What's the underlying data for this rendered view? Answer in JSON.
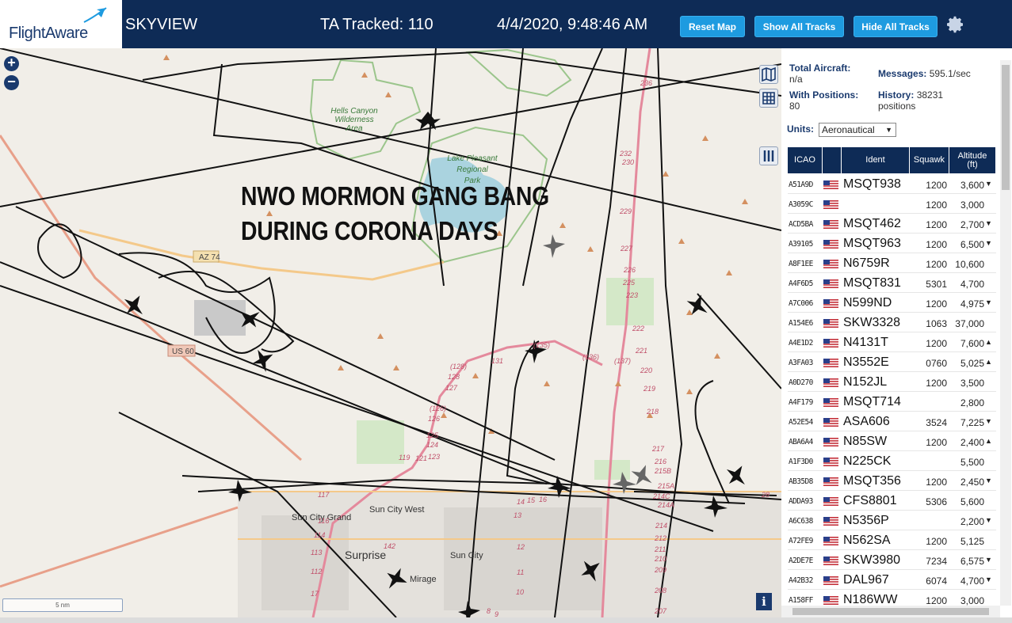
{
  "header": {
    "logo_text": "FlightAware",
    "app_name": "SKYVIEW",
    "tracked_label": "TA Tracked: 110",
    "datetime": "4/4/2020, 9:48:46 AM",
    "buttons": {
      "reset_map": "Reset Map",
      "show_all_tracks": "Show All Tracks",
      "hide_all_tracks": "Hide All Tracks"
    },
    "colors": {
      "bar": "#0e2b56",
      "button": "#1e9be0"
    }
  },
  "map": {
    "zoom_in": "+",
    "zoom_out": "−",
    "overlay_lines": [
      "NWO MORMON GANG BANG",
      "DURING CORONA DAYS"
    ],
    "scale_label": "5 nm",
    "info_icon": "i",
    "labels": {
      "hells_canyon": [
        "Hells Canyon",
        "Wilderness",
        "Area"
      ],
      "lake_pleasant": [
        "Lake Pleasant",
        "Regional",
        "Park"
      ],
      "az74": "AZ 74",
      "us60": "US 60",
      "sun_city_grand": "Sun City Grand",
      "sun_city_west": "Sun City West",
      "surprise": "Surprise",
      "sun_city": "Sun City",
      "el_mirage": "Mirage"
    },
    "road_numbers": [
      "236",
      "232",
      "230",
      "229",
      "227",
      "226",
      "225",
      "223",
      "222",
      "221",
      "220",
      "219",
      "218",
      "217",
      "216",
      "215B",
      "215A",
      "214C",
      "214A",
      "214",
      "212",
      "211",
      "210",
      "209",
      "208",
      "207",
      "(135)",
      "(136)",
      "(137)",
      "131",
      "(128)",
      "128",
      "127",
      "(126)",
      "126",
      "125",
      "124",
      "123",
      "121",
      "119",
      "117",
      "116",
      "114",
      "113",
      "112",
      "17",
      "16",
      "15",
      "14",
      "13",
      "12",
      "11",
      "10",
      "9",
      "8",
      "142",
      "28"
    ]
  },
  "panel": {
    "total_aircraft_label": "Total Aircraft:",
    "total_aircraft_value": "n/a",
    "with_positions_label": "With Positions:",
    "with_positions_value": "80",
    "messages_label": "Messages:",
    "messages_value": "595.1/sec",
    "history_label": "History:",
    "history_value": "38231",
    "history_unit": "positions",
    "units_label": "Units:",
    "units_value": "Aeronautical",
    "columns": {
      "icao": "ICAO",
      "ident": "Ident",
      "squawk": "Squawk",
      "altitude": "Altitude",
      "altitude_unit": "(ft)"
    },
    "rows": [
      {
        "icao": "A51A9D",
        "ident": "MSQT938",
        "squawk": "1200",
        "alt": "3,600",
        "trend": "▼"
      },
      {
        "icao": "A3059C",
        "ident": "",
        "squawk": "1200",
        "alt": "3,000",
        "trend": ""
      },
      {
        "icao": "ACD5BA",
        "ident": "MSQT462",
        "squawk": "1200",
        "alt": "2,700",
        "trend": "▼"
      },
      {
        "icao": "A39105",
        "ident": "MSQT963",
        "squawk": "1200",
        "alt": "6,500",
        "trend": "▼"
      },
      {
        "icao": "A8F1EE",
        "ident": "N6759R",
        "squawk": "1200",
        "alt": "10,600",
        "trend": ""
      },
      {
        "icao": "A4F6D5",
        "ident": "MSQT831",
        "squawk": "5301",
        "alt": "4,700",
        "trend": ""
      },
      {
        "icao": "A7C006",
        "ident": "N599ND",
        "squawk": "1200",
        "alt": "4,975",
        "trend": "▼"
      },
      {
        "icao": "A154E6",
        "ident": "SKW3328",
        "squawk": "1063",
        "alt": "37,000",
        "trend": ""
      },
      {
        "icao": "A4E1D2",
        "ident": "N4131T",
        "squawk": "1200",
        "alt": "7,600",
        "trend": "▲"
      },
      {
        "icao": "A3FA03",
        "ident": "N3552E",
        "squawk": "0760",
        "alt": "5,025",
        "trend": "▲"
      },
      {
        "icao": "A0D270",
        "ident": "N152JL",
        "squawk": "1200",
        "alt": "3,500",
        "trend": ""
      },
      {
        "icao": "A4F179",
        "ident": "MSQT714",
        "squawk": "",
        "alt": "2,800",
        "trend": ""
      },
      {
        "icao": "A52E54",
        "ident": "ASA606",
        "squawk": "3524",
        "alt": "7,225",
        "trend": "▼"
      },
      {
        "icao": "ABA6A4",
        "ident": "N85SW",
        "squawk": "1200",
        "alt": "2,400",
        "trend": "▲"
      },
      {
        "icao": "A1F3D0",
        "ident": "N225CK",
        "squawk": "",
        "alt": "5,500",
        "trend": ""
      },
      {
        "icao": "AB35D8",
        "ident": "MSQT356",
        "squawk": "1200",
        "alt": "2,450",
        "trend": "▼"
      },
      {
        "icao": "ADDA93",
        "ident": "CFS8801",
        "squawk": "5306",
        "alt": "5,600",
        "trend": ""
      },
      {
        "icao": "A6C638",
        "ident": "N5356P",
        "squawk": "",
        "alt": "2,200",
        "trend": "▼"
      },
      {
        "icao": "A72FE9",
        "ident": "N562SA",
        "squawk": "1200",
        "alt": "5,125",
        "trend": ""
      },
      {
        "icao": "A2DE7E",
        "ident": "SKW3980",
        "squawk": "7234",
        "alt": "6,575",
        "trend": "▼"
      },
      {
        "icao": "A42B32",
        "ident": "DAL967",
        "squawk": "6074",
        "alt": "4,700",
        "trend": "▼"
      },
      {
        "icao": "A158FF",
        "ident": "N186WW",
        "squawk": "1200",
        "alt": "3,000",
        "trend": ""
      }
    ]
  }
}
